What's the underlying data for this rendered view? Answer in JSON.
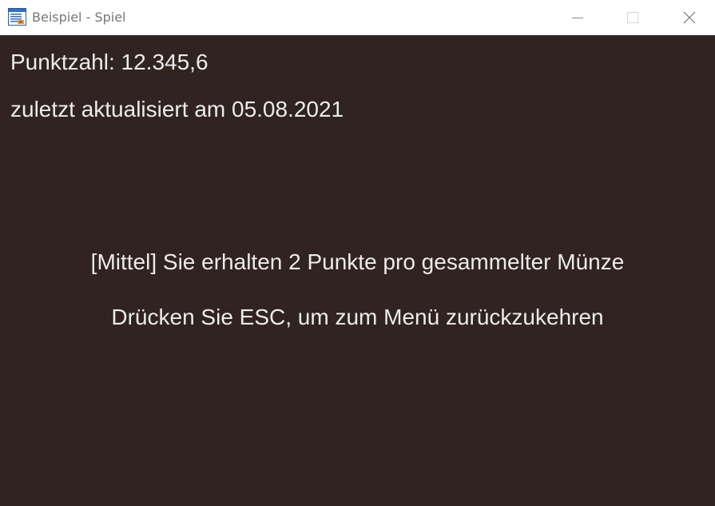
{
  "window": {
    "title": "Beispiel - Spiel",
    "icons": {
      "app": "application-window-icon",
      "minimize": "minimize-icon",
      "maximize": "maximize-icon",
      "close": "close-icon"
    }
  },
  "hud": {
    "score_text": "Punktzahl: 12.345,6",
    "updated_text": "zuletzt aktualisiert am 05.08.2021"
  },
  "message": {
    "mode_text": "[Mittel] Sie erhalten 2 Punkte pro gesammelter Münze",
    "esc_text": "Drücken Sie ESC, um zum Menü zurückzukehren"
  },
  "colors": {
    "game_background": "#302320",
    "game_text": "#ececec",
    "titlebar_background": "#ffffff",
    "titlebar_text": "#767676"
  }
}
